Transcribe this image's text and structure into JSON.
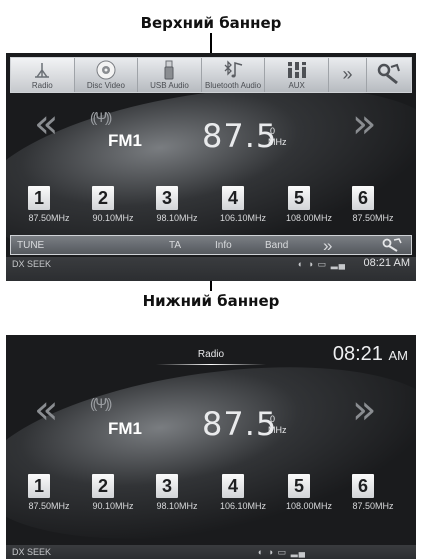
{
  "captions": {
    "top": "Верхний баннер",
    "bottom": "Нижний баннер"
  },
  "screen1": {
    "sources": [
      {
        "label": "Radio",
        "icon": "antenna-icon"
      },
      {
        "label": "Disc Video",
        "icon": "disc-icon"
      },
      {
        "label": "USB Audio",
        "icon": "usb-icon"
      },
      {
        "label": "Bluetooth Audio",
        "icon": "bluetooth-music-icon"
      },
      {
        "label": "AUX",
        "icon": "aux-icon"
      },
      {
        "label": "",
        "icon": "more-icon"
      },
      {
        "label": "",
        "icon": "settings-icon"
      }
    ],
    "band": "FM1",
    "frequency": "87.5",
    "frequency_unit_top": "0",
    "frequency_unit_bottom": "MHz",
    "presets": [
      {
        "num": "1",
        "freq": "87.50MHz"
      },
      {
        "num": "2",
        "freq": "90.10MHz"
      },
      {
        "num": "3",
        "freq": "98.10MHz"
      },
      {
        "num": "4",
        "freq": "106.10MHz"
      },
      {
        "num": "5",
        "freq": "108.00MHz"
      },
      {
        "num": "6",
        "freq": "87.50MHz"
      }
    ],
    "bottom_banner": {
      "tune": "TUNE",
      "ta": "TA",
      "info": "Info",
      "band": "Band",
      "more": "»"
    },
    "status": {
      "mode": "DX SEEK",
      "clock": "08:21 AM"
    }
  },
  "screen2": {
    "title": "Radio",
    "clock": "08:21",
    "ampm": "AM",
    "band": "FM1",
    "frequency": "87.5",
    "frequency_unit_top": "0",
    "frequency_unit_bottom": "MHz",
    "presets": [
      {
        "num": "1",
        "freq": "87.50MHz"
      },
      {
        "num": "2",
        "freq": "90.10MHz"
      },
      {
        "num": "3",
        "freq": "98.10MHz"
      },
      {
        "num": "4",
        "freq": "106.10MHz"
      },
      {
        "num": "5",
        "freq": "108.00MHz"
      },
      {
        "num": "6",
        "freq": "87.50MHz"
      }
    ],
    "status": {
      "mode": "DX SEEK"
    }
  }
}
